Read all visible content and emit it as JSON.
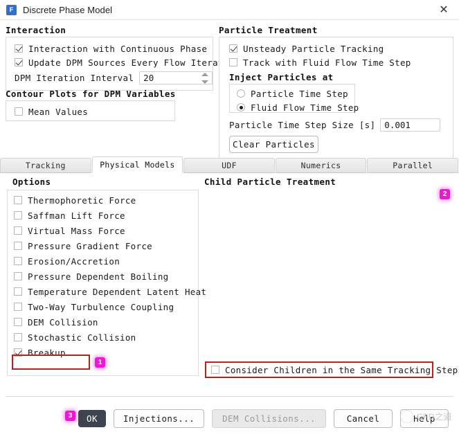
{
  "window": {
    "title": "Discrete Phase Model",
    "icon": "fluent-app-icon",
    "icon_letter": "F",
    "close_label": "✕"
  },
  "interaction": {
    "title": "Interaction",
    "checkboxes": [
      {
        "label": "Interaction with Continuous Phase",
        "checked": true
      },
      {
        "label": "Update DPM Sources Every Flow Iteration",
        "checked": true
      }
    ],
    "iteration_interval": {
      "label": "DPM Iteration Interval",
      "value": "20"
    }
  },
  "contour_plots": {
    "title": "Contour Plots for DPM Variables",
    "checkboxes": [
      {
        "label": "Mean Values",
        "checked": false
      }
    ]
  },
  "particle_treatment": {
    "title": "Particle Treatment",
    "checkboxes": [
      {
        "label": "Unsteady Particle Tracking",
        "checked": true
      },
      {
        "label": "Track with Fluid Flow Time Step",
        "checked": false
      }
    ],
    "inject_title": "Inject Particles at",
    "inject_options": [
      {
        "label": "Particle Time Step",
        "selected": false
      },
      {
        "label": "Fluid Flow Time Step",
        "selected": true
      }
    ],
    "time_step_size": {
      "label": "Particle Time Step Size [s]",
      "value": "0.001"
    },
    "clear_particles_label": "Clear Particles"
  },
  "tabs": [
    {
      "label": "Tracking",
      "active": false
    },
    {
      "label": "Physical Models",
      "active": true
    },
    {
      "label": "UDF",
      "active": false
    },
    {
      "label": "Numerics",
      "active": false
    },
    {
      "label": "Parallel",
      "active": false
    }
  ],
  "options": {
    "title": "Options",
    "items": [
      {
        "label": "Thermophoretic Force",
        "checked": false
      },
      {
        "label": "Saffman Lift Force",
        "checked": false
      },
      {
        "label": "Virtual Mass Force",
        "checked": false
      },
      {
        "label": "Pressure Gradient Force",
        "checked": false
      },
      {
        "label": "Erosion/Accretion",
        "checked": false
      },
      {
        "label": "Pressure Dependent Boiling",
        "checked": false
      },
      {
        "label": "Temperature Dependent Latent Heat",
        "checked": false
      },
      {
        "label": "Two-Way Turbulence Coupling",
        "checked": false
      },
      {
        "label": "DEM Collision",
        "checked": false
      },
      {
        "label": "Stochastic Collision",
        "checked": false
      },
      {
        "label": "Breakup",
        "checked": true
      }
    ]
  },
  "child_particle_treatment": {
    "title": "Child Particle Treatment",
    "checkbox": {
      "label": "Consider Children in the Same Tracking Step",
      "checked": false
    }
  },
  "badges": [
    {
      "number": "1"
    },
    {
      "number": "2"
    },
    {
      "number": "3"
    }
  ],
  "footer": {
    "ok_label": "OK",
    "injections_label": "Injections...",
    "dem_collisions_label": "DEM Collisions...",
    "cancel_label": "Cancel",
    "help_label": "Help"
  },
  "watermark": {
    "text": "CFD之道"
  },
  "colors": {
    "highlight_red": "#bb1f1f",
    "badge_magenta": "#ee18d2",
    "ok_button": "#3d4450"
  }
}
